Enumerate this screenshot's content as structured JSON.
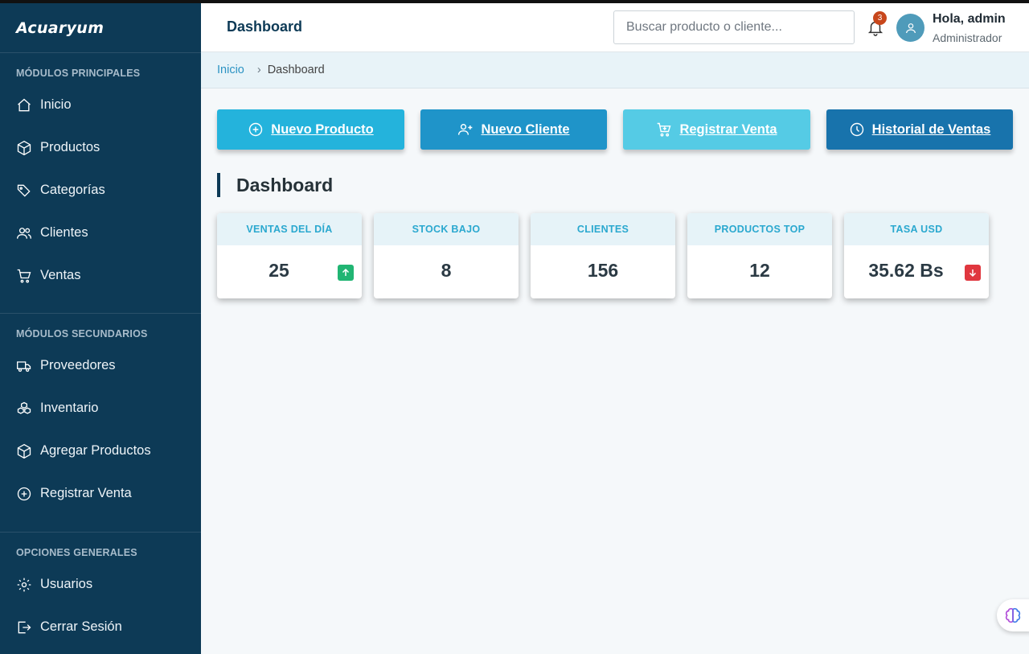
{
  "sidebar": {
    "brand": "Acuaryum",
    "sections": [
      {
        "title": "MÓDULOS PRINCIPALES",
        "items": [
          "Inicio",
          "Productos",
          "Categorías",
          "Clientes",
          "Ventas"
        ]
      },
      {
        "title": "MÓDULOS SECUNDARIOS",
        "items": [
          "Proveedores",
          "Inventario",
          "Agregar Productos",
          "Registrar Venta"
        ]
      },
      {
        "title": "OPCIONES GENERALES",
        "items": [
          "Usuarios",
          "Cerrar Sesión"
        ]
      }
    ]
  },
  "header": {
    "title": "Dashboard",
    "search_placeholder": "Buscar producto o cliente...",
    "notifications_count": "3",
    "user_greeting": "Hola, admin",
    "user_role": "Administrador"
  },
  "breadcrumb": {
    "home": "Inicio",
    "separator": "›",
    "current": "Dashboard"
  },
  "actions": [
    "Nuevo Producto",
    "Nuevo Cliente",
    "Registrar Venta",
    "Historial de Ventas"
  ],
  "section_title": "Dashboard",
  "stats": [
    {
      "label": "VENTAS DEL DÍA",
      "value": "25",
      "trend": "up"
    },
    {
      "label": "STOCK BAJO",
      "value": "8"
    },
    {
      "label": "CLIENTES",
      "value": "156"
    },
    {
      "label": "PRODUCTOS TOP",
      "value": "12"
    },
    {
      "label": "TASA USD",
      "value": "35.62 Bs",
      "trend": "down"
    }
  ],
  "colors": {
    "sidebar_bg": "#0d3a56",
    "trend_up": "#21b573",
    "trend_down": "#e0373f",
    "badge": "#c8471c"
  }
}
